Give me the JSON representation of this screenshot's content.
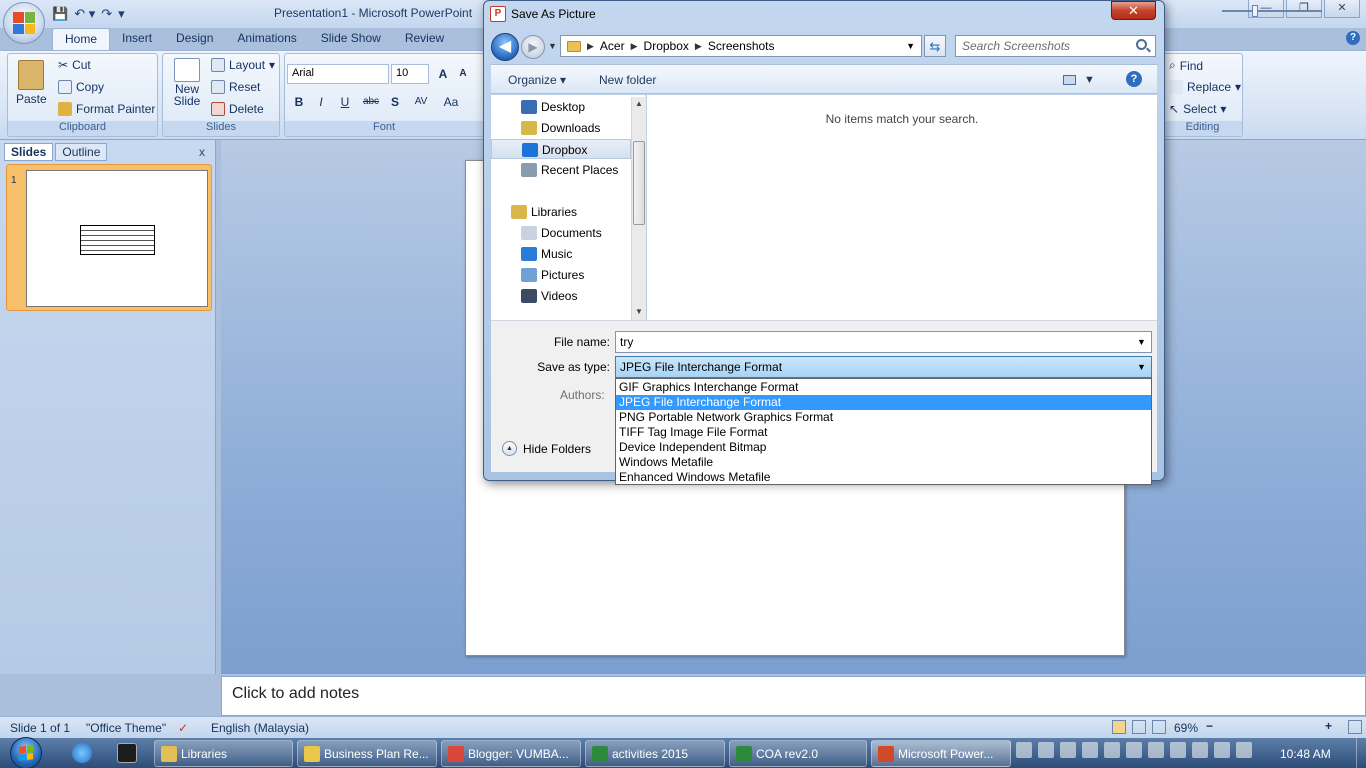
{
  "app": {
    "title": "Presentation1 - Microsoft PowerPoint",
    "qat": {
      "save": "💾",
      "undo": "↶ ▾",
      "redo": "↷",
      "customize": "▾"
    },
    "window_controls": {
      "minimize": "—",
      "restore": "❐",
      "close": "✕"
    }
  },
  "ribbon": {
    "tabs": [
      "Home",
      "Insert",
      "Design",
      "Animations",
      "Slide Show",
      "Review"
    ],
    "clipboard": {
      "label": "Clipboard",
      "paste": "Paste",
      "cut": "Cut",
      "copy": "Copy",
      "format_painter": "Format Painter"
    },
    "slides": {
      "label": "Slides",
      "new_slide": "New Slide",
      "layout": "Layout",
      "reset": "Reset",
      "delete": "Delete"
    },
    "font": {
      "label": "Font",
      "font_name": "Arial",
      "font_size": "10",
      "grow": "A",
      "shrink": "A",
      "bold": "B",
      "italic": "I",
      "underline": "U",
      "strike": "abc",
      "shadow": "S",
      "spacing": "AV",
      "case": "Aa"
    },
    "editing": {
      "label": "Editing",
      "find": "Find",
      "replace": "Replace",
      "select": "Select"
    }
  },
  "slides_pane": {
    "tabs": [
      "Slides",
      "Outline"
    ],
    "close": "x",
    "slide_number": "1"
  },
  "notes": {
    "placeholder": "Click to add notes"
  },
  "status": {
    "slide": "Slide 1 of 1",
    "theme": "\"Office Theme\"",
    "language": "English (Malaysia)",
    "zoom": "69%",
    "zoom_minus": "−",
    "zoom_plus": "+"
  },
  "dialog": {
    "title": "Save As Picture",
    "close": "✕",
    "back": "◀",
    "forward": "▶",
    "breadcrumbs": [
      "Acer",
      "Dropbox",
      "Screenshots"
    ],
    "search_placeholder": "Search Screenshots",
    "organize": "Organize ▾",
    "new_folder": "New folder",
    "help": "?",
    "nav_items": [
      {
        "label": "Desktop",
        "icon": "desktop-icon",
        "color": "#3b6db3"
      },
      {
        "label": "Downloads",
        "icon": "downloads-icon",
        "color": "#d9b64a"
      },
      {
        "label": "Dropbox",
        "icon": "dropbox-icon",
        "color": "#1e73d8"
      },
      {
        "label": "Recent Places",
        "icon": "recent-places-icon",
        "color": "#8a9bb0"
      }
    ],
    "libraries": {
      "label": "Libraries",
      "color": "#d9b64a"
    },
    "library_items": [
      {
        "label": "Documents",
        "icon": "documents-icon",
        "color": "#c9d3df"
      },
      {
        "label": "Music",
        "icon": "music-icon",
        "color": "#2b7bd8"
      },
      {
        "label": "Pictures",
        "icon": "pictures-icon",
        "color": "#6fa1d6"
      },
      {
        "label": "Videos",
        "icon": "videos-icon",
        "color": "#3a4b63"
      }
    ],
    "empty_message": "No items match your search.",
    "file_name_label": "File name:",
    "file_name_value": "try",
    "save_as_type_label": "Save as type:",
    "save_as_type_value": "JPEG File Interchange Format",
    "authors_label": "Authors:",
    "hide_folders": "Hide Folders",
    "type_options": [
      "GIF Graphics Interchange Format",
      "JPEG File Interchange Format",
      "PNG Portable Network Graphics Format",
      "TIFF Tag Image File Format",
      "Device Independent Bitmap",
      "Windows Metafile",
      "Enhanced Windows Metafile"
    ],
    "selected_type_index": 1
  },
  "taskbar": {
    "buttons": [
      {
        "label": "Libraries",
        "icon": "folder-icon",
        "color": "#e2bf55"
      },
      {
        "label": "Business Plan Re...",
        "icon": "pdf-icon",
        "color": "#e8c84a"
      },
      {
        "label": "Blogger: VUMBA...",
        "icon": "chrome-icon",
        "color": "#d8473a"
      },
      {
        "label": "activities 2015",
        "icon": "excel-icon",
        "color": "#2b8a3e"
      },
      {
        "label": "COA rev2.0",
        "icon": "excel-icon",
        "color": "#2b8a3e"
      },
      {
        "label": "Microsoft Power...",
        "icon": "powerpoint-icon",
        "color": "#d2492a"
      }
    ],
    "clock": "10:48 AM"
  }
}
